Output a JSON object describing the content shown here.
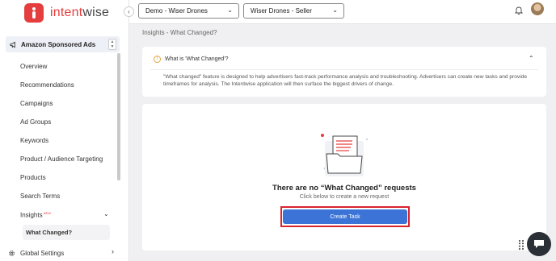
{
  "brand": {
    "name_part1": "intent",
    "name_part2": "wise",
    "accent": "#e53e3e"
  },
  "topbar": {
    "account_select": "Demo - Wiser Drones",
    "profile_select": "Wiser Drones - Seller",
    "collapse_icon": "chevron-left-icon",
    "notifications_icon": "bell-icon"
  },
  "sidebar": {
    "product": "Amazon Sponsored Ads",
    "items": [
      {
        "label": "Overview"
      },
      {
        "label": "Recommendations"
      },
      {
        "label": "Campaigns"
      },
      {
        "label": "Ad Groups"
      },
      {
        "label": "Keywords"
      },
      {
        "label": "Product / Audience Targeting"
      },
      {
        "label": "Products"
      },
      {
        "label": "Search Terms"
      },
      {
        "label": "Insights",
        "badge": "NEW"
      }
    ],
    "sub_item": "What Changed?",
    "global_settings": "Global Settings"
  },
  "main": {
    "breadcrumb": "Insights - What Changed?",
    "info_card": {
      "title": "What is 'What Changed'?",
      "description": "\"What changed\" feature is designed to help advertisers fast-track performance analysis and troubleshooting. Advertisers can create new tasks and provide timeframes for analysis. The Intentwise application will then surface the biggest drivers of change."
    },
    "empty_state": {
      "title": "There are no “What Changed” requests",
      "subtitle": "Click below to create a new request",
      "button": "Create Task"
    }
  },
  "colors": {
    "primary_button": "#3b74d6",
    "highlight_outline": "#d9232d"
  }
}
